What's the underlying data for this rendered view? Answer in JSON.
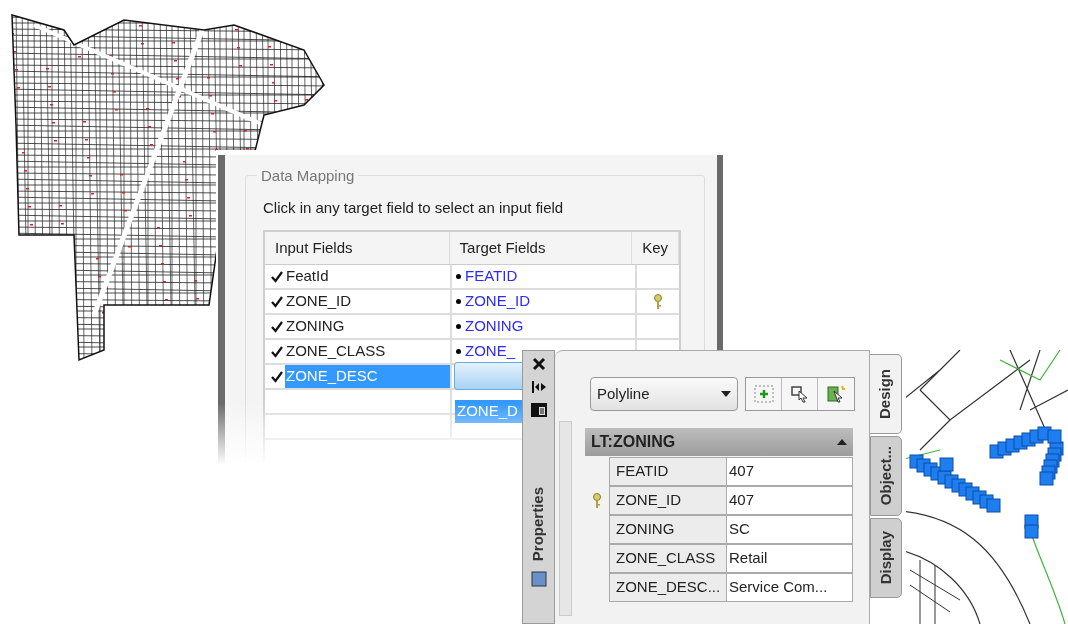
{
  "data_mapping": {
    "title": "Data Mapping",
    "instruction": "Click in any target field to select an input field",
    "columns": [
      "Input Fields",
      "Target Fields",
      "Key"
    ],
    "rows": [
      {
        "input": "FeatId",
        "checked": true,
        "target": "FEATID",
        "key": false,
        "selected": false
      },
      {
        "input": "ZONE_ID",
        "checked": true,
        "target": "ZONE_ID",
        "key": true,
        "selected": false
      },
      {
        "input": "ZONING",
        "checked": true,
        "target": "ZONING",
        "key": false,
        "selected": false
      },
      {
        "input": "ZONE_CLASS",
        "checked": true,
        "target": "ZONE_",
        "key": false,
        "selected": false
      },
      {
        "input": "ZONE_DESC",
        "checked": true,
        "target": "",
        "key": false,
        "selected": true
      }
    ],
    "dropdown_option": {
      "label": "ZONE_D",
      "selected": true
    }
  },
  "properties_palette": {
    "title": "Properties",
    "object_type": "Polyline",
    "category": {
      "name": "LT:ZONING",
      "expanded": true
    },
    "properties": [
      {
        "name": "FEATID",
        "value": "407",
        "key": false
      },
      {
        "name": "ZONE_ID",
        "value": "407",
        "key": true
      },
      {
        "name": "ZONING",
        "value": "SC",
        "key": false
      },
      {
        "name": "ZONE_CLASS",
        "value": "Retail",
        "key": false
      },
      {
        "name": "ZONE_DESC...",
        "value": "Service Com...",
        "key": false
      }
    ],
    "tabs": [
      {
        "label": "Design",
        "selected": true
      },
      {
        "label": "Object...",
        "selected": false
      },
      {
        "label": "Display",
        "selected": false
      }
    ]
  }
}
